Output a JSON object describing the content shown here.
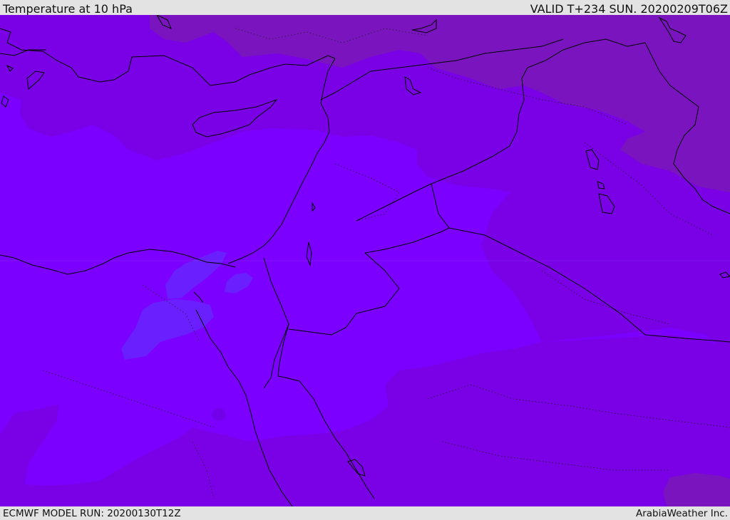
{
  "header": {
    "title": "Temperature at 10 hPa",
    "valid_time": "VALID T+234 SUN. 20200209T06Z"
  },
  "footer": {
    "model_run": "ECMWF MODEL RUN: 20200130T12Z",
    "credit": "ArabiaWeather Inc."
  },
  "colors": {
    "band_cold": "#6a1fff",
    "band_main": "#7b00ff",
    "band_mid": "#7a00e6",
    "band_warm": "#7a14bf",
    "coast": "#000000",
    "header_bg": "#e3e3e3"
  }
}
